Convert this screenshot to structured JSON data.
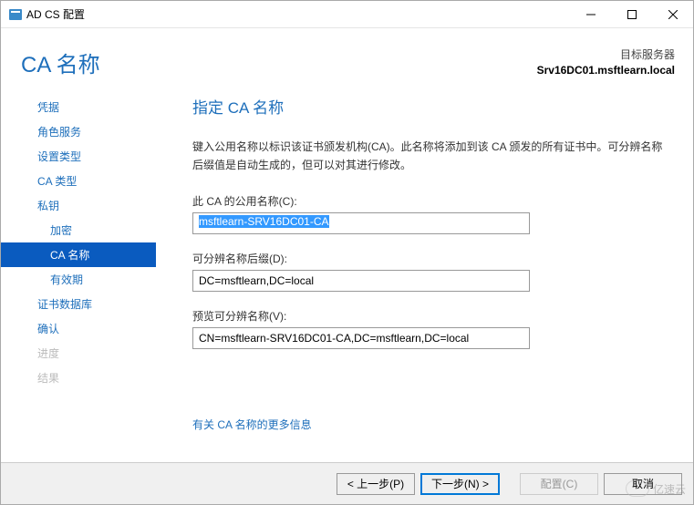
{
  "titlebar": {
    "title": "AD CS 配置"
  },
  "header": {
    "heading": "CA 名称",
    "target_label": "目标服务器",
    "target_server": "Srv16DC01.msftlearn.local"
  },
  "sidebar": {
    "credentials": "凭据",
    "role_services": "角色服务",
    "setup_type": "设置类型",
    "ca_type": "CA 类型",
    "private_key": "私钥",
    "cryptography": "加密",
    "ca_name": "CA 名称",
    "validity": "有效期",
    "cert_db": "证书数据库",
    "confirm": "确认",
    "progress": "进度",
    "results": "结果"
  },
  "main": {
    "section_title": "指定 CA 名称",
    "description": "键入公用名称以标识该证书颁发机构(CA)。此名称将添加到该 CA 颁发的所有证书中。可分辨名称后缀值是自动生成的，但可以对其进行修改。",
    "common_name_label": "此 CA 的公用名称(C):",
    "common_name_value": "msftlearn-SRV16DC01-CA",
    "dn_suffix_label": "可分辨名称后缀(D):",
    "dn_suffix_value": "DC=msftlearn,DC=local",
    "preview_label": "预览可分辨名称(V):",
    "preview_value": "CN=msftlearn-SRV16DC01-CA,DC=msftlearn,DC=local",
    "more_info": "有关 CA 名称的更多信息"
  },
  "footer": {
    "prev": "< 上一步(P)",
    "next": "下一步(N) >",
    "configure": "配置(C)",
    "cancel": "取消"
  },
  "watermark": "亿速云"
}
